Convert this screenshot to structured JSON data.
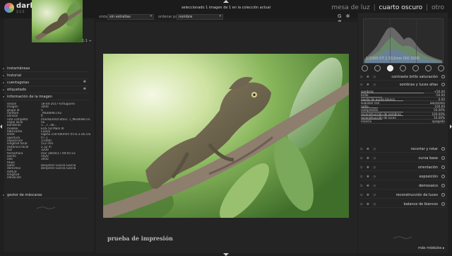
{
  "app": {
    "name": "darktable",
    "version": "2.2.5",
    "status": "seleccionado 1 imagen de 1 en la colección actual",
    "views": [
      "mesa de luz",
      "cuarto oscuro",
      "otro"
    ],
    "active_view": "cuarto oscuro"
  },
  "filterbar": {
    "view_label": "vista",
    "view_value": "sin estrellas",
    "sort_label": "ordenar por",
    "sort_value": "nombre",
    "icons": [
      "G",
      "✲",
      "✲"
    ]
  },
  "left_panel": {
    "nav_zoom": "1:1 ÷",
    "modules": [
      {
        "label": "instantáneas",
        "icon": ""
      },
      {
        "label": "historial",
        "icon": ""
      },
      {
        "label": "cuentagotas",
        "icon": "✱"
      },
      {
        "label": "etiquetado",
        "icon": "✱"
      },
      {
        "label": "información de la imagen",
        "icon": ""
      }
    ],
    "image_info": [
      [
        "sesión",
        "18-04-2017-Tortuguero"
      ],
      [
        "imagen",
        "3000"
      ],
      [
        "grupo id",
        "5"
      ],
      [
        "nombre",
        "_MG6698.CR2"
      ],
      [
        "versión",
        "0"
      ],
      [
        "ruta completa",
        "/media/sdc/Fotos/.../_MG6698.CR2"
      ],
      [
        "copia local",
        "no"
      ],
      [
        "banderas",
        "1 ...r...ab..."
      ],
      [
        "modelo",
        "EOS 5D Mark III"
      ],
      [
        "fabricante",
        "Canon"
      ],
      [
        "lente",
        "Sigma 150-600mm f/5-6.3 DG OS HSM"
      ],
      [
        "apertura",
        "f/7.1"
      ],
      [
        "exposición",
        "1/1000"
      ],
      [
        "longitud focal",
        "512 mm"
      ],
      [
        "distancia focal",
        "2.32 m"
      ],
      [
        "ISO",
        "3200"
      ],
      [
        "fecha/hora",
        "mar 18/04/17 09:05:53"
      ],
      [
        "ancho",
        "5920"
      ],
      [
        "alto",
        "3950"
      ],
      [
        "título",
        ""
      ],
      [
        "autor",
        "Benjamín García García"
      ],
      [
        "derechos",
        "Benjamín García García"
      ],
      [
        "latitud",
        ""
      ],
      [
        "longitud",
        ""
      ],
      [
        "elevación",
        ""
      ]
    ],
    "bottom_module": "gestor de máscaras"
  },
  "center": {
    "caption": "prueba de impresión"
  },
  "right_panel": {
    "histogram_caption": "1/1000  f/7.1  512mm  ISO 3200",
    "module_group_icons": [
      "power-icon",
      "favorites-icon",
      "basic-icon",
      "tone-icon",
      "color-icon",
      "correct-icon",
      "effect-icon"
    ],
    "active_group": 2,
    "modules_top": [
      {
        "label": "contraste brillo saturación"
      },
      {
        "label": "sombras y luces altas"
      }
    ],
    "shadows_highlights": [
      {
        "label": "sombras",
        "value": "+50.00",
        "fraction": 0.75
      },
      {
        "label": "brillo",
        "value": "-50.00",
        "fraction": 0.25
      },
      {
        "label": "ajuste de punto blanco",
        "value": "0.00",
        "fraction": 0.5
      },
      {
        "label": "suavizar con",
        "value": "gaussiano",
        "fraction": 0.0
      },
      {
        "label": "radio",
        "value": "100.00",
        "fraction": 0.2
      },
      {
        "label": "compresión",
        "value": "50.00%",
        "fraction": 0.5
      },
      {
        "label": "reconstrucción de sombras",
        "value": "100.00%",
        "fraction": 0.5
      },
      {
        "label": "reconstrucción de luces",
        "value": "50.00%",
        "fraction": 0.25
      },
      {
        "label": "mezcla",
        "value": "apagado",
        "fraction": 0.0
      }
    ],
    "modules_bottom": [
      {
        "label": "recortar y rotar"
      },
      {
        "label": "curva base"
      },
      {
        "label": "orientación"
      },
      {
        "label": "exposición"
      },
      {
        "label": "demosaico"
      },
      {
        "label": "reconstrucción de luces"
      },
      {
        "label": "balance de blancos"
      }
    ],
    "more_modules": "más módulos ▸"
  },
  "colors": {
    "background": "#1f1f1f",
    "panel": "#242424",
    "text": "#bdbdbd"
  }
}
